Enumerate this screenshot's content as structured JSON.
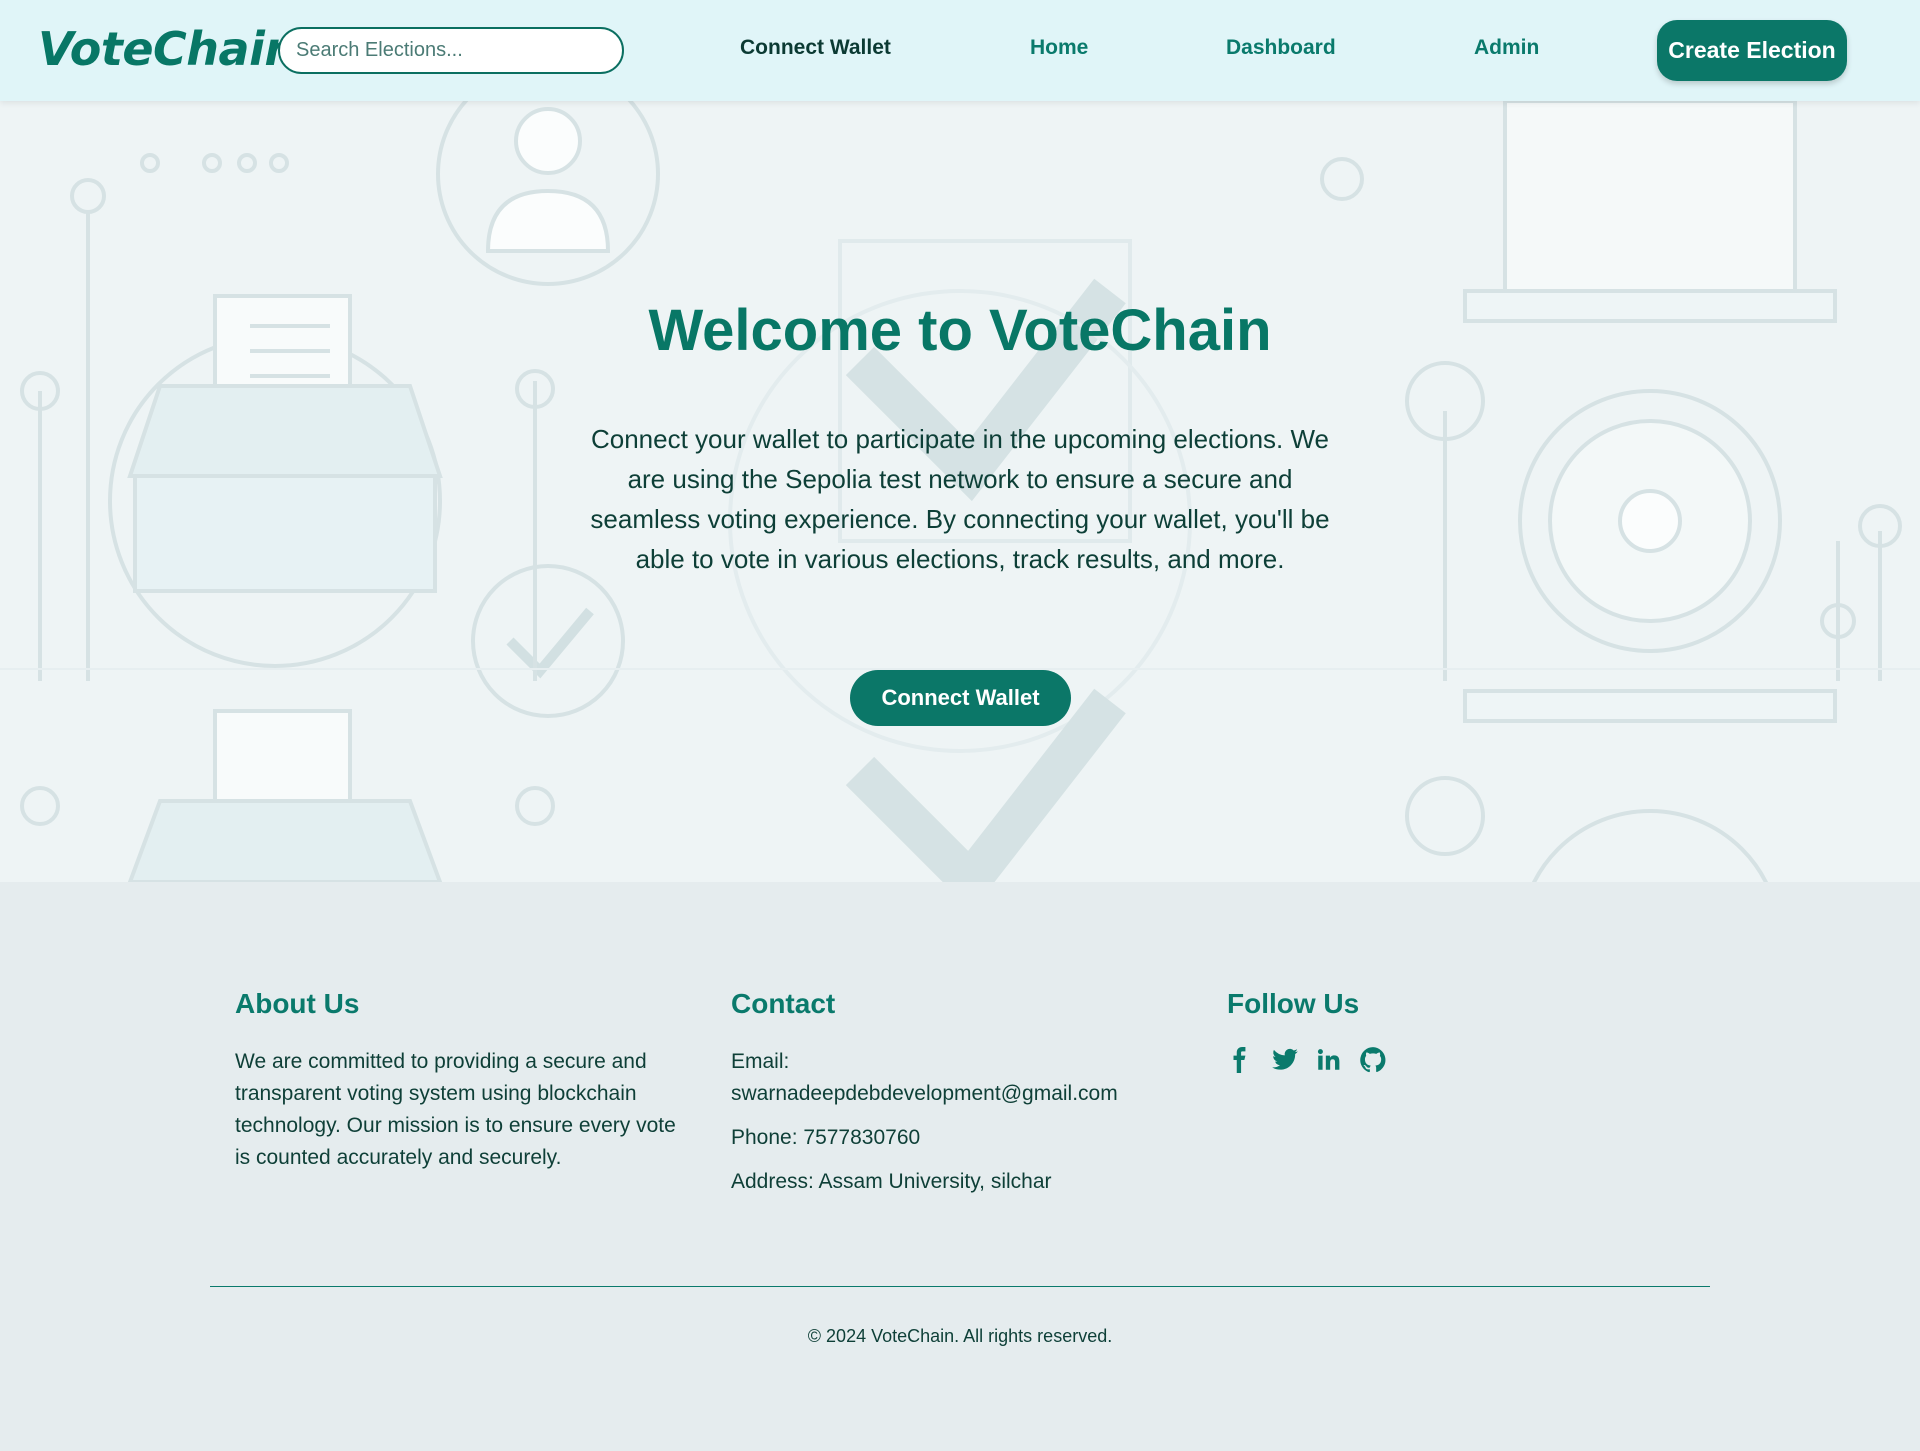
{
  "navbar": {
    "logo": "VoteChain",
    "search_placeholder": "Search Elections...",
    "links": {
      "connect_wallet": "Connect Wallet",
      "home": "Home",
      "dashboard": "Dashboard",
      "admin": "Admin"
    },
    "create_button": "Create Election"
  },
  "hero": {
    "title": "Welcome to VoteChain",
    "text": "Connect your wallet to participate in the upcoming elections. We are using the Sepolia test network to ensure a secure and seamless voting experience. By connecting your wallet, you'll be able to vote in various elections, track results, and more.",
    "button": "Connect Wallet"
  },
  "footer": {
    "about": {
      "heading": "About Us",
      "text": "We are committed to providing a secure and transparent voting system using blockchain technology. Our mission is to ensure every vote is counted accurately and securely."
    },
    "contact": {
      "heading": "Contact",
      "email_label": "Email:",
      "email": "swarnadeepdebdevelopment@gmail.com",
      "phone": "Phone: 7577830760",
      "address": "Address: Assam University, silchar"
    },
    "follow": {
      "heading": "Follow Us",
      "icons": [
        "facebook-icon",
        "twitter-icon",
        "linkedin-icon",
        "github-icon"
      ]
    },
    "copyright": "© 2024 VoteChain. All rights reserved."
  },
  "colors": {
    "brand": "#0b7768",
    "nav_bg": "#e0f5f8",
    "footer_bg": "#e5ecee"
  }
}
